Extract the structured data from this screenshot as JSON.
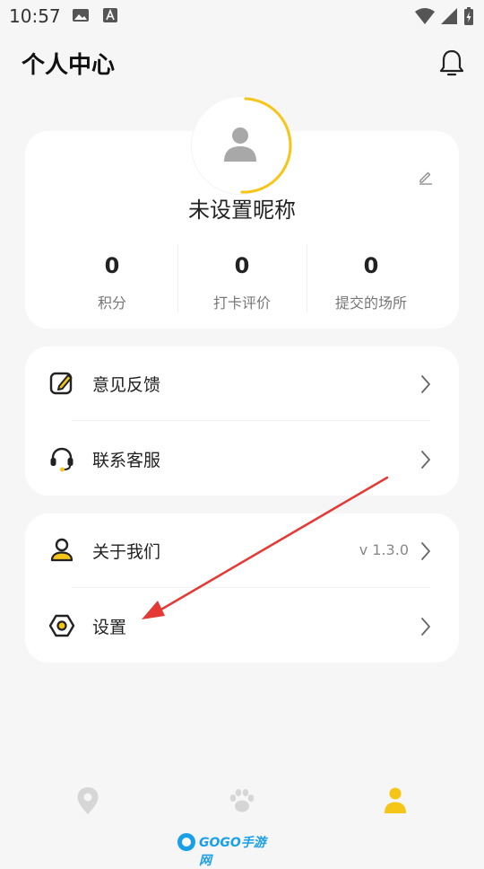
{
  "status_bar": {
    "time": "10:57"
  },
  "header": {
    "title": "个人中心"
  },
  "profile": {
    "nickname": "未设置昵称",
    "stats": [
      {
        "value": "0",
        "label": "积分"
      },
      {
        "value": "0",
        "label": "打卡评价"
      },
      {
        "value": "0",
        "label": "提交的场所"
      }
    ]
  },
  "menu_group_1": [
    {
      "label": "意见反馈",
      "icon": "feedback-edit-icon"
    },
    {
      "label": "联系客服",
      "icon": "headset-icon"
    }
  ],
  "menu_group_2": [
    {
      "label": "关于我们",
      "icon": "user-icon",
      "value": "v 1.3.0"
    },
    {
      "label": "设置",
      "icon": "settings-icon"
    }
  ],
  "tabbar": {
    "items": [
      {
        "icon": "map-pin-icon",
        "active": false
      },
      {
        "icon": "paw-icon",
        "active": false
      },
      {
        "icon": "profile-icon",
        "active": true
      }
    ]
  },
  "watermark": {
    "text": "GOGO手游网"
  },
  "colors": {
    "accent": "#f5c518",
    "annotation_arrow": "#e53935",
    "card": "#ffffff",
    "background": "#f6f6f6"
  }
}
